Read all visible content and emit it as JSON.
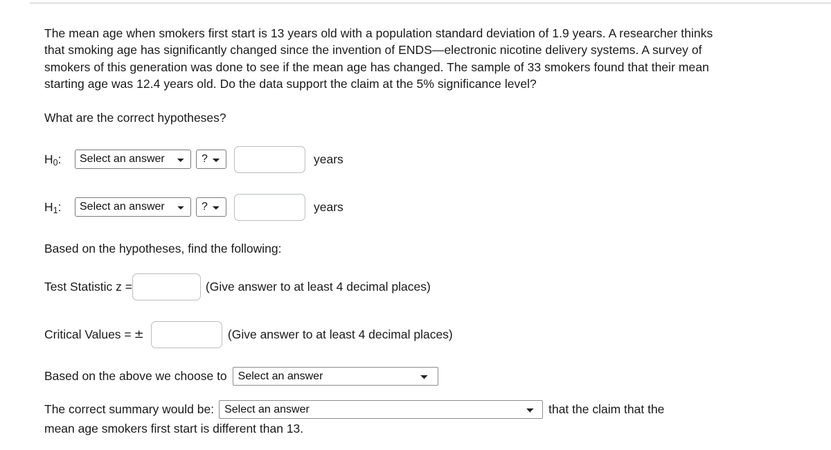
{
  "problem": {
    "statement": "The mean age when smokers first start is 13 years old with a population standard deviation of 1.9 years. A researcher thinks that smoking age has significantly changed since the invention of ENDS—electronic nicotine delivery systems. A survey of smokers of this generation was done to see if the mean age has changed. The sample of 33 smokers found that their mean starting age was 12.4 years old. Do the data support the claim at the 5% significance level?",
    "hypotheses_question": "What are the correct hypotheses?"
  },
  "hypotheses": {
    "null": {
      "label": "H",
      "subscript": "0",
      "colon": ":",
      "parameter_select_value": "Select an answer",
      "comparator_select_value": "?",
      "value_input": "",
      "unit": "years"
    },
    "alternative": {
      "label": "H",
      "subscript": "1",
      "colon": ":",
      "parameter_select_value": "Select an answer",
      "comparator_select_value": "?",
      "value_input": "",
      "unit": "years"
    }
  },
  "findings": {
    "intro": "Based on the hypotheses, find the following:",
    "test_statistic": {
      "label": "Test Statistic z =",
      "value": "",
      "hint": "(Give answer to at least 4 decimal places)"
    },
    "critical_values": {
      "label": "Critical Values =",
      "plus_minus": "±",
      "value": "",
      "hint": "(Give answer to at least 4 decimal places)"
    }
  },
  "decision": {
    "prefix": "Based on the above we choose to",
    "select_value": "Select an answer"
  },
  "summary": {
    "prefix": "The correct summary would be:",
    "select_value": "Select an answer",
    "tail": "that the claim that the",
    "second_line": "mean age smokers first start is different than 13."
  },
  "colors": {
    "text": "#1a1a1a",
    "divider": "#e6e7e9",
    "input_border": "#b9bcbe",
    "select_border": "#7a7a7a",
    "background": "#ffffff"
  }
}
